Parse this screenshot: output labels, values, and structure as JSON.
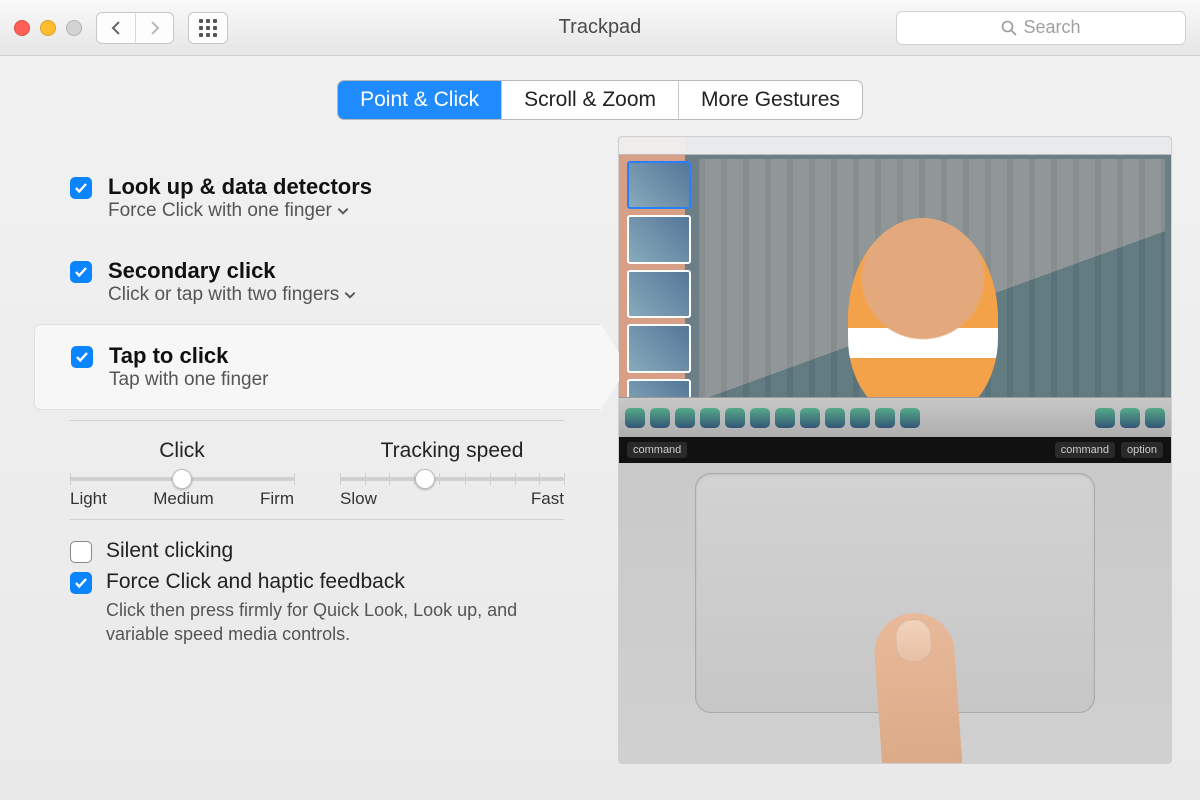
{
  "window": {
    "title": "Trackpad"
  },
  "search": {
    "placeholder": "Search"
  },
  "tabs": [
    {
      "label": "Point & Click",
      "active": true
    },
    {
      "label": "Scroll & Zoom",
      "active": false
    },
    {
      "label": "More Gestures",
      "active": false
    }
  ],
  "options": [
    {
      "title": "Look up & data detectors",
      "subtitle": "Force Click with one finger",
      "has_dropdown": true,
      "checked": true,
      "selected": false
    },
    {
      "title": "Secondary click",
      "subtitle": "Click or tap with two fingers",
      "has_dropdown": true,
      "checked": true,
      "selected": false
    },
    {
      "title": "Tap to click",
      "subtitle": "Tap with one finger",
      "has_dropdown": false,
      "checked": true,
      "selected": true
    }
  ],
  "sliders": {
    "click": {
      "label": "Click",
      "min_label": "Light",
      "mid_label": "Medium",
      "max_label": "Firm",
      "ticks": 3,
      "value_pct": 50
    },
    "tracking": {
      "label": "Tracking speed",
      "min_label": "Slow",
      "max_label": "Fast",
      "ticks": 10,
      "value_pct": 38
    }
  },
  "bottom": {
    "silent": {
      "label": "Silent clicking",
      "checked": false
    },
    "force": {
      "label": "Force Click and haptic feedback",
      "checked": true,
      "desc": "Click then press firmly for Quick Look, Look up, and variable speed media controls."
    }
  },
  "touchbar_keys": {
    "left": "command",
    "right1": "command",
    "right2": "option"
  }
}
